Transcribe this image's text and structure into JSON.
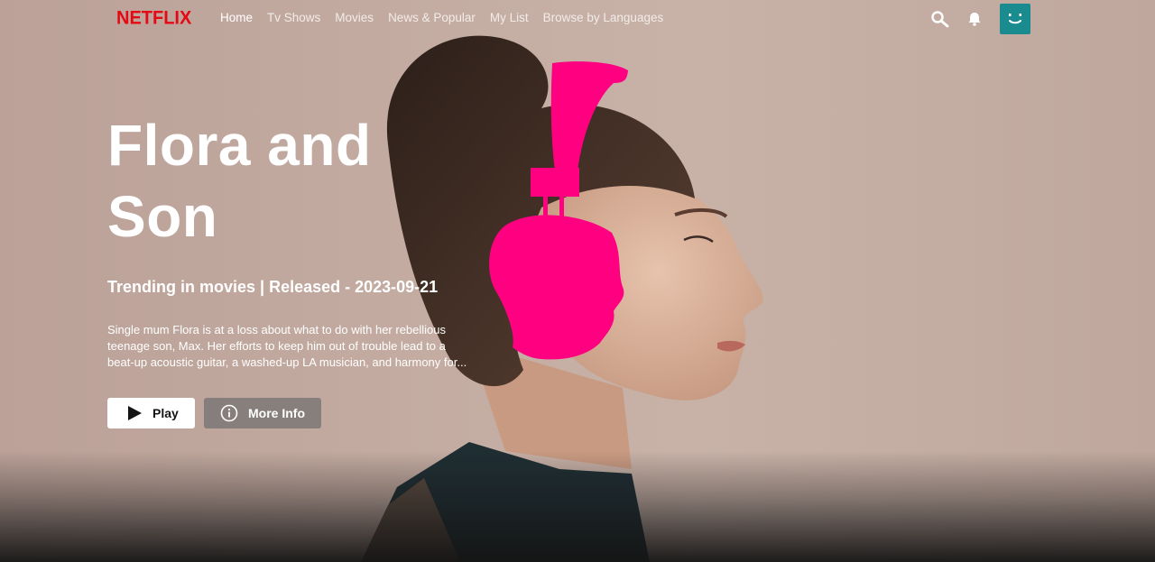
{
  "brand": {
    "logo_text": "NETFLIX",
    "color": "#e50914"
  },
  "nav": {
    "links": [
      {
        "label": "Home",
        "active": true
      },
      {
        "label": "Tv Shows"
      },
      {
        "label": "Movies"
      },
      {
        "label": "News & Popular"
      },
      {
        "label": "My List"
      },
      {
        "label": "Browse by Languages"
      }
    ],
    "icons": [
      "search-icon",
      "bell-icon"
    ],
    "avatar_color": "#1a8b8f"
  },
  "hero": {
    "title": "Flora and Son",
    "tagline": "Trending in movies | Released - 2023-09-21",
    "description": "Single mum Flora is at a loss about what to do with her rebellious teenage son, Max. Her efforts to keep him out of trouble lead to a beat-up acoustic guitar, a washed-up LA musician, and harmony for...",
    "accent_color": "#ff0080"
  },
  "actions": {
    "play_label": "Play",
    "more_info_label": "More Info"
  }
}
